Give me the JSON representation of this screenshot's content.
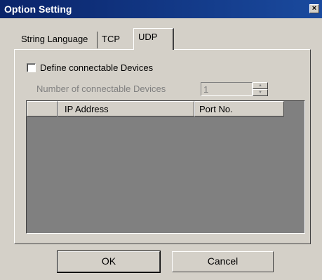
{
  "window": {
    "title": "Option Setting",
    "close_glyph": "×"
  },
  "tabs": [
    {
      "label": "String Language",
      "active": false
    },
    {
      "label": "TCP",
      "active": false
    },
    {
      "label": "UDP",
      "active": true
    }
  ],
  "udp": {
    "define_devices": {
      "label": "Define connectable Devices",
      "checked": false
    },
    "num_devices": {
      "label": "Number of connectable Devices",
      "value": "1",
      "enabled": false
    },
    "table": {
      "columns": [
        "",
        "IP Address",
        "Port No."
      ],
      "rows": []
    }
  },
  "buttons": {
    "ok": "OK",
    "cancel": "Cancel"
  },
  "colors": {
    "titlebar": "#0a246a",
    "dialog_bg": "#d4d0c8",
    "list_bg": "#808080"
  }
}
